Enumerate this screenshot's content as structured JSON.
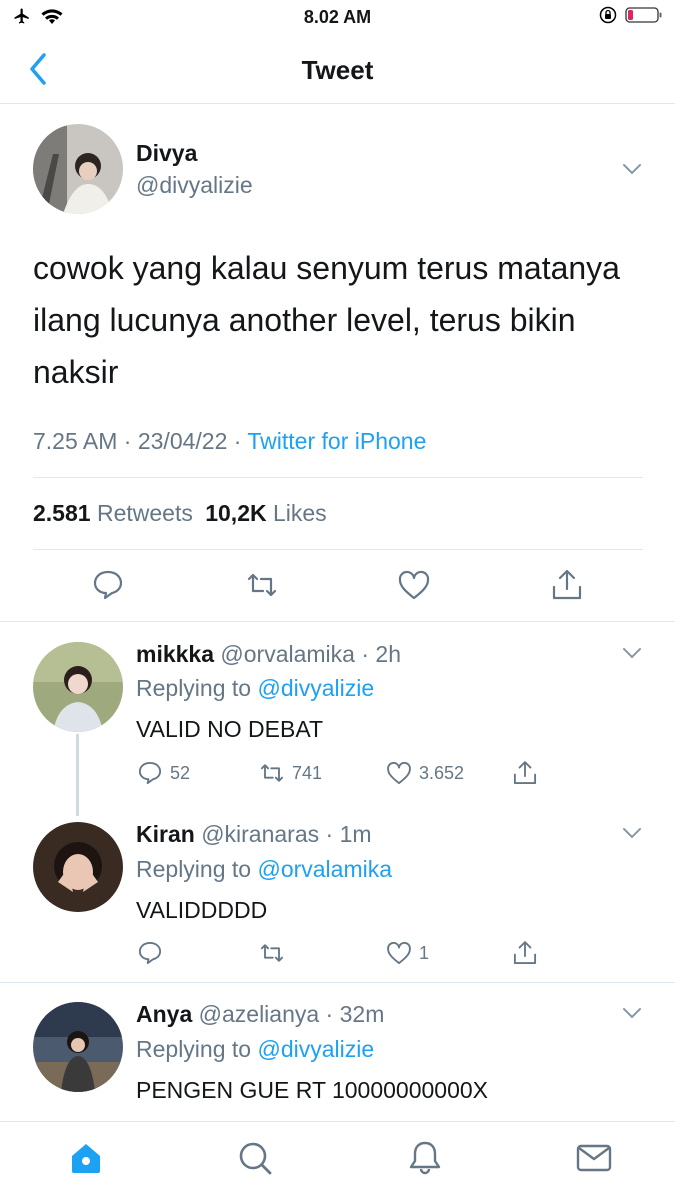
{
  "status_bar": {
    "time": "8.02 AM"
  },
  "nav": {
    "title": "Tweet"
  },
  "tweet": {
    "name": "Divya",
    "handle": "@divyalizie",
    "text": "cowok yang kalau senyum terus matanya ilang lucunya another level, terus bikin naksir",
    "time": "7.25 AM",
    "date": "23/04/22",
    "source": "Twitter for iPhone",
    "retweets_count": "2.581",
    "retweets_label": "Retweets",
    "likes_count": "10,2K",
    "likes_label": "Likes"
  },
  "replies": [
    {
      "name": "mikkka",
      "handle": "@orvalamika",
      "age": "2h",
      "replying_prefix": "Replying to",
      "replying_to": "@divyalizie",
      "text": "VALID NO DEBAT",
      "reply_count": "52",
      "retweet_count": "741",
      "like_count": "3.652"
    },
    {
      "name": "Kiran",
      "handle": "@kiranaras",
      "age": "1m",
      "replying_prefix": "Replying to",
      "replying_to": "@orvalamika",
      "text": "VALIDDDDD",
      "reply_count": "",
      "retweet_count": "",
      "like_count": "1"
    },
    {
      "name": "Anya",
      "handle": "@azelianya",
      "age": "32m",
      "replying_prefix": "Replying to",
      "replying_to": "@divyalizie",
      "text": "PENGEN GUE RT 10000000000X"
    }
  ],
  "colors": {
    "accent": "#1da1f2",
    "muted": "#657786",
    "battery_low": "#e0245e"
  },
  "icons": {
    "back": "chevron-left-icon",
    "reply": "speech-bubble-icon",
    "retweet": "retweet-icon",
    "like": "heart-icon",
    "share": "share-icon",
    "home": "home-icon",
    "search": "search-icon",
    "notifications": "bell-icon",
    "messages": "mail-icon"
  }
}
